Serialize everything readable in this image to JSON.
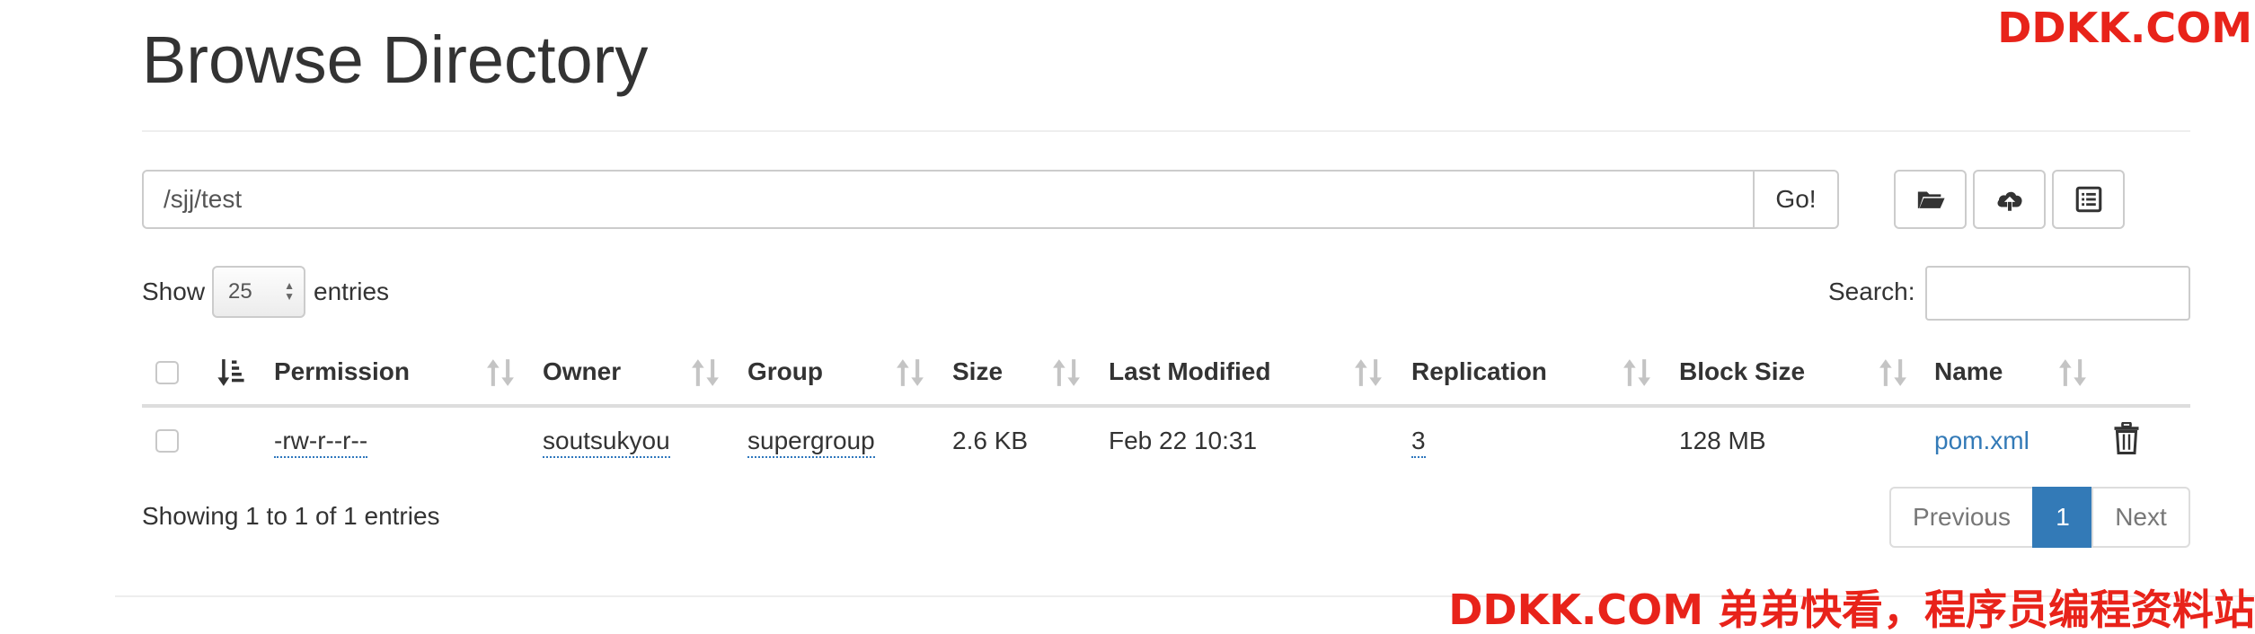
{
  "watermark": {
    "top": "DDKK.COM",
    "bottom": "DDKK.COM 弟弟快看，程序员编程资料站"
  },
  "page_title": "Browse Directory",
  "path_input": {
    "value": "/sjj/test"
  },
  "go_label": "Go!",
  "toolbar": {
    "icons": [
      "folder-open-icon",
      "upload-cloud-icon",
      "list-alt-icon"
    ]
  },
  "length": {
    "show": "Show",
    "value": "25",
    "entries": "entries"
  },
  "search": {
    "label": "Search:",
    "value": ""
  },
  "table": {
    "headers": {
      "permission": "Permission",
      "owner": "Owner",
      "group": "Group",
      "size": "Size",
      "modified": "Last Modified",
      "replication": "Replication",
      "block_size": "Block Size",
      "name": "Name"
    },
    "rows": [
      {
        "permission": "-rw-r--r--",
        "owner": "soutsukyou",
        "group": "supergroup",
        "size": "2.6 KB",
        "modified": "Feb 22 10:31",
        "replication": "3",
        "block_size": "128 MB",
        "name": "pom.xml"
      }
    ]
  },
  "info": "Showing 1 to 1 of 1 entries",
  "pagination": {
    "previous": "Previous",
    "current": "1",
    "next": "Next"
  },
  "colors": {
    "accent": "#337ab7",
    "watermark": "#e8231a",
    "border": "#cccccc"
  }
}
